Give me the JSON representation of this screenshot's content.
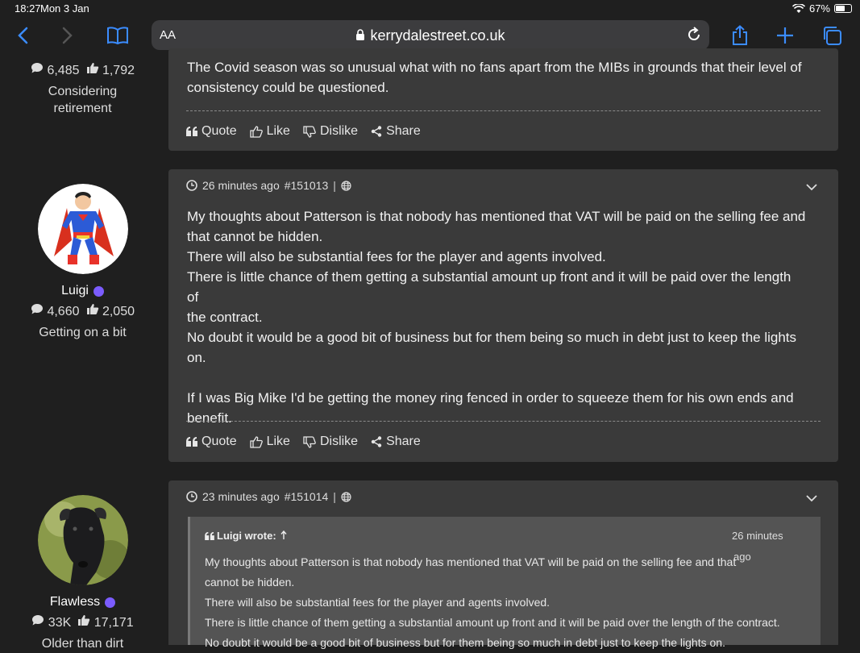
{
  "status": {
    "time": "18:27",
    "date": "Mon 3 Jan",
    "battery": "67%",
    "battery_level": 0.67
  },
  "browser": {
    "aa": "AA",
    "url": "kerrydalestreet.co.uk"
  },
  "users": [
    {
      "posts": "6,485",
      "likes": "1,792",
      "rank_line1": "Considering",
      "rank_line2": "retirement"
    },
    {
      "name": "Luigi",
      "posts": "4,660",
      "likes": "2,050",
      "rank": "Getting on a bit"
    },
    {
      "name": "Flawless",
      "posts": "33K",
      "likes": "17,171",
      "rank": "Older than dirt"
    }
  ],
  "posts": [
    {
      "body": [
        "The Covid season was so unusual what with no fans apart from the MIBs in grounds that their level of",
        "consistency could be questioned."
      ],
      "actions": {
        "quote": "Quote",
        "like": "Like",
        "dislike": "Dislike",
        "share": "Share"
      }
    },
    {
      "time": "26 minutes ago",
      "id": "#151013",
      "body": [
        "My thoughts about Patterson is that nobody has mentioned that VAT will be paid on the selling fee and",
        "that cannot be hidden.",
        "There will also be substantial fees for the player and agents involved.",
        "There is little chance of them getting a substantial amount up front and it will be paid over the length of",
        "the contract.",
        "No doubt it would be a good bit of business but for them being so much in debt just to keep the lights",
        "on.",
        "",
        "If I was Big Mike I'd be getting the money ring fenced in order to squeeze them for his own ends and",
        "benefit."
      ],
      "actions": {
        "quote": "Quote",
        "like": "Like",
        "dislike": "Dislike",
        "share": "Share"
      }
    },
    {
      "time": "23 minutes ago",
      "id": "#151014",
      "quote_author": "Luigi wrote:",
      "quote_time_line1": "26 minutes",
      "quote_time_line2": "ago",
      "quote_body": [
        "My thoughts about Patterson is that nobody has mentioned that VAT will be paid on the selling fee and that",
        "cannot be hidden.",
        "There will also be substantial fees for the player and agents involved.",
        "There is little chance of them getting a substantial amount up front and it will be paid over the length of the contract.",
        "No doubt it would be a good bit of business but for them being so much in debt just to keep the lights on."
      ]
    }
  ]
}
